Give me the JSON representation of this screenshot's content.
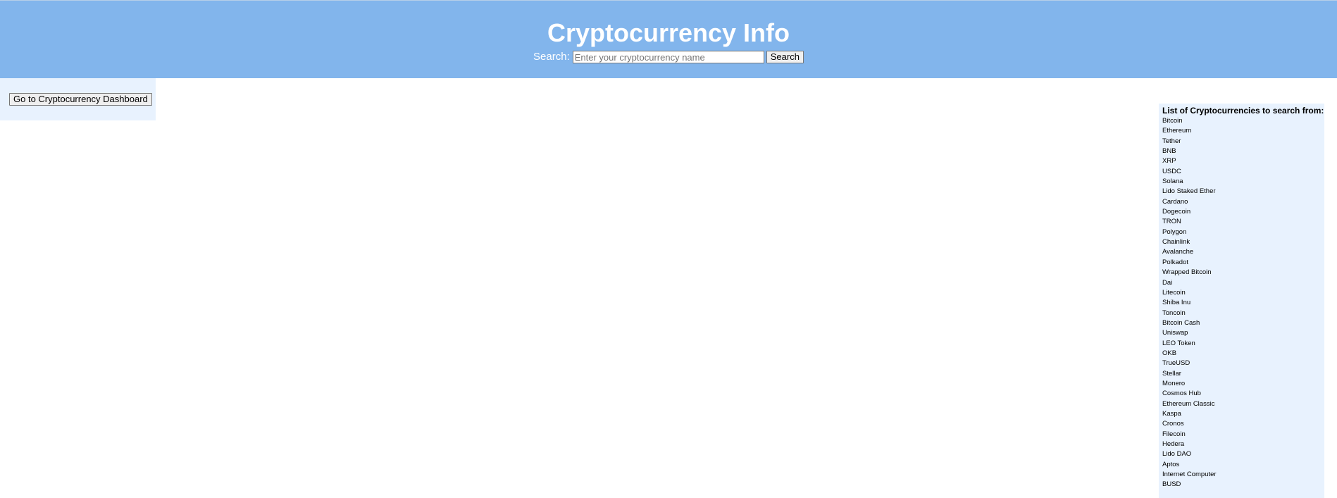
{
  "header": {
    "title": "Cryptocurrency Info",
    "search_label": "Search:",
    "search_placeholder": "Enter your cryptocurrency name",
    "search_button": "Search"
  },
  "left_panel": {
    "dashboard_button": "Go to Cryptocurrency Dashboard"
  },
  "crypto_list": {
    "heading": "List of Cryptocurrencies to search from:",
    "items": [
      "Bitcoin",
      "Ethereum",
      "Tether",
      "BNB",
      "XRP",
      "USDC",
      "Solana",
      "Lido Staked Ether",
      "Cardano",
      "Dogecoin",
      "TRON",
      "Polygon",
      "Chainlink",
      "Avalanche",
      "Polkadot",
      "Wrapped Bitcoin",
      "Dai",
      "Litecoin",
      "Shiba Inu",
      "Toncoin",
      "Bitcoin Cash",
      "Uniswap",
      "LEO Token",
      "OKB",
      "TrueUSD",
      "Stellar",
      "Monero",
      "Cosmos Hub",
      "Ethereum Classic",
      "Kaspa",
      "Cronos",
      "Filecoin",
      "Hedera",
      "Lido DAO",
      "Aptos",
      "Internet Computer",
      "BUSD"
    ]
  },
  "colors": {
    "header_bg": "#82b5ec",
    "panel_bg": "#e8f2fe"
  }
}
